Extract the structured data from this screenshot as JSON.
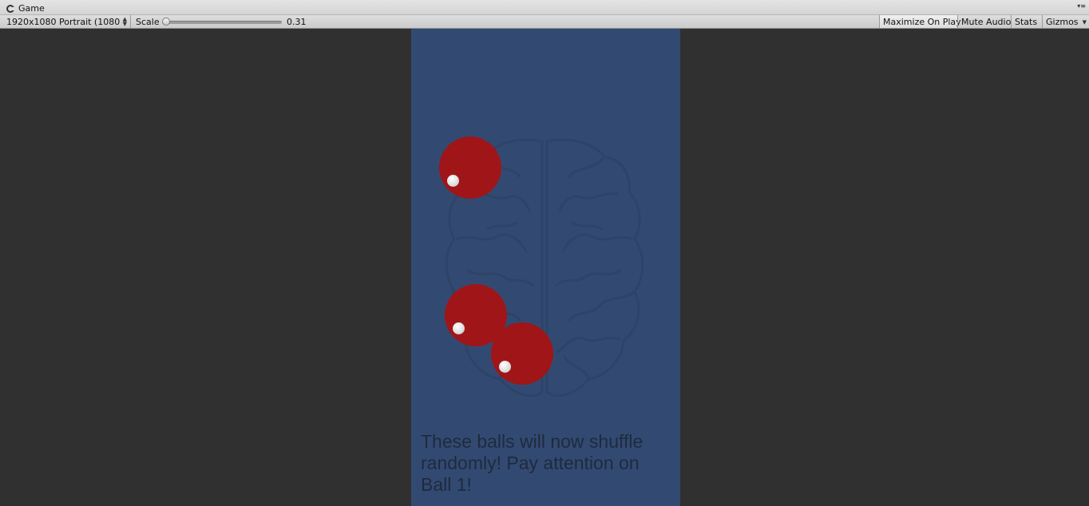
{
  "window": {
    "tab_title": "Game"
  },
  "toolbar": {
    "resolution": "1920x1080 Portrait (1080x",
    "scale_label": "Scale",
    "scale_value": "0.31",
    "scale_level": 0.0,
    "maximize_label": "Maximize On Play",
    "mute_label": "Mute Audio",
    "stats_label": "Stats",
    "gizmos_label": "Gizmos"
  },
  "game": {
    "background_color": "#324a72",
    "ball_color": "#a01518",
    "instruction": "These balls will now shuffle randomly! Pay attention on Ball 1!"
  },
  "icons": {
    "tab_icon": "unity-game-icon",
    "menu": "menu-dots-icon",
    "dropdown": "chevron-updown-icon",
    "brain": "brain-icon"
  }
}
